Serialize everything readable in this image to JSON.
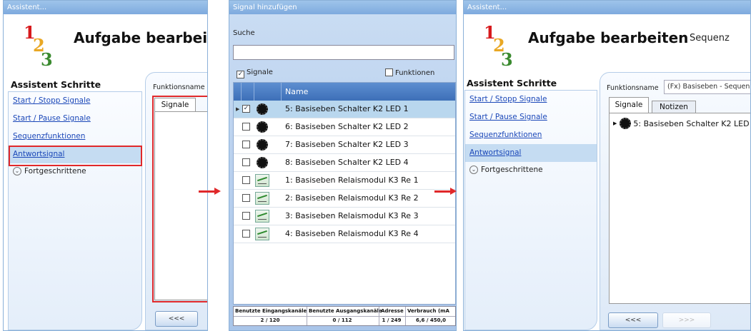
{
  "window1": {
    "title": "Assistent...",
    "heading": "Aufgabe bearbeite",
    "logo_digits": [
      "1",
      "2",
      "3"
    ],
    "steps_title": "Assistent Schritte",
    "steps": [
      "Start / Stopp Signale",
      "Start / Pause Signale",
      "Sequenzfunktionen",
      "Antwortsignal"
    ],
    "advanced_label": "Fortgeschrittene",
    "function_name_label": "Funktionsname",
    "tab_signals": "Signale",
    "back_button": "<<<"
  },
  "window2": {
    "title": "Signal hinzufügen",
    "search_label": "Suche",
    "filter_signals": "Signale",
    "filter_functions": "Funktionen",
    "column_name": "Name",
    "rows": [
      {
        "name": "5: Basiseben Schalter K2 LED 1",
        "icon": "led-icon",
        "checked": true,
        "selected": true
      },
      {
        "name": "6: Basiseben Schalter K2 LED 2",
        "icon": "led-icon",
        "checked": false,
        "selected": false
      },
      {
        "name": "7: Basiseben Schalter K2 LED 3",
        "icon": "led-icon",
        "checked": false,
        "selected": false
      },
      {
        "name": "8: Basiseben Schalter K2 LED 4",
        "icon": "led-icon",
        "checked": false,
        "selected": false
      },
      {
        "name": "1: Basiseben Relaismodul K3 Re 1",
        "icon": "relay-icon",
        "checked": false,
        "selected": false
      },
      {
        "name": "2: Basiseben Relaismodul K3 Re 2",
        "icon": "relay-icon",
        "checked": false,
        "selected": false
      },
      {
        "name": "3: Basiseben Relaismodul K3 Re 3",
        "icon": "relay-icon",
        "checked": false,
        "selected": false
      },
      {
        "name": "4: Basiseben Relaismodul K3 Re 4",
        "icon": "relay-icon",
        "checked": false,
        "selected": false
      }
    ],
    "stats": {
      "inputs_label": "Benutzte Eingangskanäle",
      "inputs_value": "2 / 120",
      "outputs_label": "Benutzte Ausgangskanäle",
      "outputs_value": "0 / 112",
      "address_label": "Adresse",
      "address_value": "1 / 249",
      "consumption_label": "Verbrauch (mA",
      "consumption_value": "6,6 / 450,0"
    }
  },
  "window3": {
    "title": "Assistent...",
    "heading": "Aufgabe bearbeiten",
    "subheading": "Sequenz",
    "logo_digits": [
      "1",
      "2",
      "3"
    ],
    "steps_title": "Assistent Schritte",
    "steps": [
      "Start / Stopp Signale",
      "Start / Pause Signale",
      "Sequenzfunktionen",
      "Antwortsignal"
    ],
    "advanced_label": "Fortgeschrittene",
    "function_name_label": "Funktionsname",
    "function_name_value": "(Fx) Basiseben - Sequen",
    "tab_signals": "Signale",
    "tab_notes": "Notizen",
    "signal_item": "5: Basiseben Schalter K2 LED",
    "back_button": "<<<",
    "next_button": ">>>"
  },
  "colors": {
    "highlight": "#e0282a",
    "link": "#1a47b8",
    "grid_header": "#3d6fb8"
  }
}
